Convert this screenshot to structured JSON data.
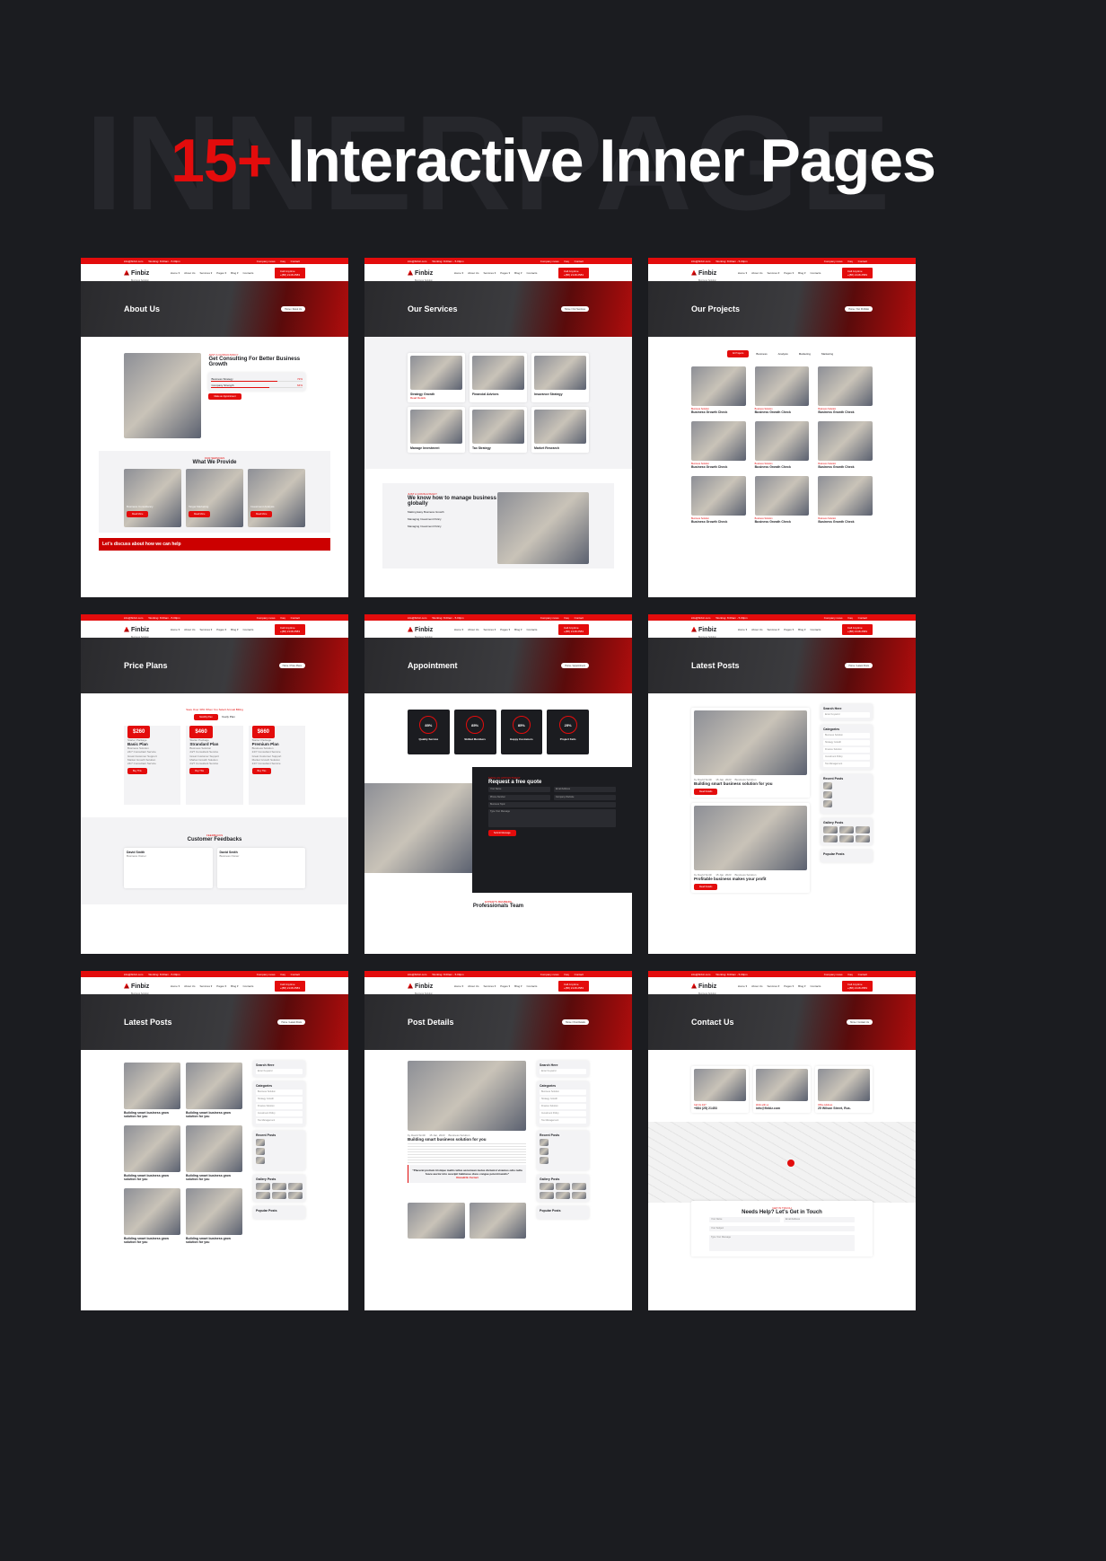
{
  "background_word": "INNERPAGE",
  "headline": {
    "accent": "15+",
    "text": " Interactive Inner Pages"
  },
  "colors": {
    "accent": "#e30c0c",
    "background": "#1b1c20"
  },
  "common": {
    "email": "info@finbiz.com",
    "hours": "Working: 8.00am - 5.00pm",
    "top_links": [
      "Company news",
      "Faq",
      "Contact"
    ],
    "logo": "Finbiz",
    "tagline": "Business Solution",
    "nav": [
      "Home ▾",
      "About Us",
      "Services ▾",
      "Pages ▾",
      "Blog ▾",
      "Contacts"
    ],
    "call_label": "Call Anytime",
    "phone": "+(88) 2148.2583"
  },
  "pages": [
    {
      "title": "About Us",
      "crumb": "Home / About Us",
      "type": "about",
      "kicker": "JUST A CONSULTANCY",
      "heading": "Get Consulting For Better Business Growth",
      "bars": [
        {
          "label": "Business Strategy",
          "value": "72%",
          "pct": 72
        },
        {
          "label": "Company Strength",
          "value": "64%",
          "pct": 64
        }
      ],
      "button": "Make an Appointment",
      "section_kicker": "OUR SERVICES",
      "section_title": "What We Provide",
      "services": [
        "Business Consultancy",
        "Target Marketing",
        "Investment Analysis"
      ],
      "read_more": "Read More",
      "footer": "Let's discuss about how we can help"
    },
    {
      "title": "Our Services",
      "crumb": "Home / Our Services",
      "type": "services",
      "services": [
        "Strategy Growth",
        "Financial Advices",
        "Insurance Strategy",
        "Manage Investment",
        "Tax Strategy",
        "Market Research"
      ],
      "read_more": "Read Details",
      "kicker": "JUST A CONSULTANCY",
      "heading": "We know how to manage business globally",
      "list": [
        "Making Easy Business Growth",
        "Managing Investment Policy",
        "Managing Investment Policy"
      ]
    },
    {
      "title": "Our Projects",
      "crumb": "Home / Our Portfolio",
      "type": "projects",
      "filters": [
        "All Projects",
        "Business",
        "Analysis",
        "Marketing",
        "Marketing"
      ],
      "tile_kicker": "Business Solution",
      "tile_title": "Business Growth Check"
    },
    {
      "title": "Price Plans",
      "crumb": "Home / Price Plans",
      "type": "price",
      "note": "Save Over 30% When You Select Annual Billing",
      "toggle": [
        "Monthly Plan",
        "Yearly Plan"
      ],
      "plans": [
        {
          "price": "$260",
          "name": "Basic Plan",
          "pkg": "Starter Package"
        },
        {
          "price": "$460",
          "name": "Strandard Plan",
          "pkg": "Starter Package"
        },
        {
          "price": "$660",
          "name": "Premium Plan",
          "pkg": "Starter Package"
        }
      ],
      "features": [
        "Business Solution",
        "24/7 Consultant Service",
        "Great Customer Support",
        "Market Growth Solution",
        "24/7 Consultant Service"
      ],
      "buy": "Buy This",
      "section_kicker": "FEEDBACKS",
      "section_title": "Customer Feedbacks",
      "reviewer": "David Smith",
      "reviewer_role": "Business Owner"
    },
    {
      "title": "Appointment",
      "crumb": "Home / Appointment",
      "type": "appointment",
      "stats": [
        {
          "value": "85%",
          "label": "Quality Service"
        },
        {
          "value": "85%",
          "label": "Skilled Members"
        },
        {
          "value": "85%",
          "label": "Happy Customers"
        },
        {
          "value": "25%",
          "label": "Project Fails"
        }
      ],
      "form_kicker": "MAKE AN APPOINTMENT",
      "form_title": "Request a free quote",
      "fields": [
        "Your Name",
        "Email Address",
        "Phone Number",
        "Company Website"
      ],
      "topic": "Business Topic",
      "message": "Type Your Message",
      "submit": "Submit Message",
      "team_kicker": "EXPERTS MEMBERS",
      "team_title": "Professionals Team"
    },
    {
      "title": "Latest Posts",
      "crumb": "Home / Latest Posts",
      "type": "blog",
      "meta": [
        "by David Smith",
        "15 Jan, 2023",
        "Business Solution"
      ],
      "posts": [
        "Building smart business solution for you",
        "Profitable business makes your profit"
      ],
      "read": "Read Details",
      "sidebar": [
        "Search Here",
        "Categories",
        "Recent Posts",
        "Gallery Posts",
        "Popular Posts"
      ],
      "search_placeholder": "Enter Keyword",
      "categories": [
        "Business Solution",
        "Strategy Growth",
        "Finance Solution",
        "Investment Policy",
        "Tax Management"
      ]
    },
    {
      "title": "Latest Posts",
      "crumb": "Home / Latest Posts",
      "type": "grid",
      "post_title": "Building smart business grow solution for you",
      "sidebar": [
        "Search Here",
        "Categories",
        "Recent Posts",
        "Gallery Posts",
        "Popular Posts"
      ],
      "search_placeholder": "Enter Keyword",
      "categories": [
        "Business Solution",
        "Strategy Growth",
        "Finance Solution",
        "Investment Policy",
        "Tax Management"
      ]
    },
    {
      "title": "Post Details",
      "crumb": "Home / Post Details",
      "type": "details",
      "meta": [
        "by David Smith",
        "15 Jan, 2023",
        "Business Solution"
      ],
      "post_title": "Building smart business solution for you",
      "quote": "\"Placerat pretium tristique mattis tellus accumsan metus dictumst vivamus odio nulla fusce auctor into suscipit habitasse class congue potenti iaculis\"",
      "quote_author": "Ronald B. Ferrari",
      "sidebar": [
        "Search Here",
        "Categories",
        "Recent Posts",
        "Gallery Posts",
        "Popular Posts"
      ],
      "search_placeholder": "Enter Keyword",
      "categories": [
        "Business Solution",
        "Strategy Growth",
        "Finance Solution",
        "Investment Policy",
        "Tax Management"
      ]
    },
    {
      "title": "Contact Us",
      "crumb": "Home / Contact Us",
      "type": "contact",
      "contacts": [
        {
          "label": "Call Us 24/7",
          "value": "+884 (25) 21453"
        },
        {
          "label": "Work with us",
          "value": "info@finbiz.com"
        },
        {
          "label": "Office Address",
          "value": "25 Wilson Street, Rus."
        }
      ],
      "form_kicker": "GET IN TOUCH",
      "form_title": "Needs Help? Let's Get in Touch",
      "fields": [
        "Your Name",
        "Email Address",
        "Your Subject",
        "Type Your Message"
      ]
    }
  ]
}
